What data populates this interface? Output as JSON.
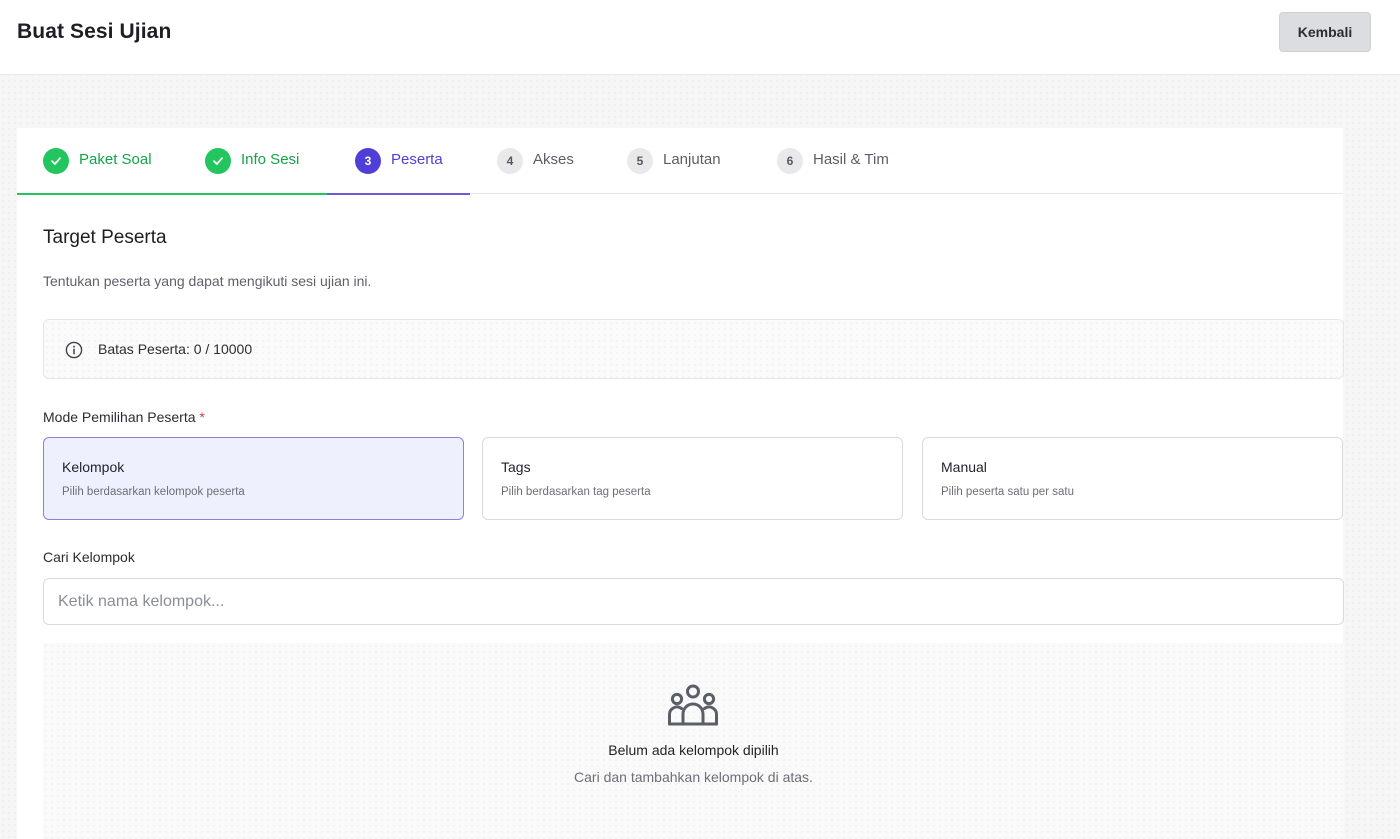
{
  "header": {
    "title": "Buat Sesi Ujian",
    "back_label": "Kembali"
  },
  "stepper": {
    "steps": [
      {
        "number": "1",
        "label": "Paket Soal",
        "state": "done"
      },
      {
        "number": "2",
        "label": "Info Sesi",
        "state": "done"
      },
      {
        "number": "3",
        "label": "Peserta",
        "state": "active"
      },
      {
        "number": "4",
        "label": "Akses",
        "state": "todo"
      },
      {
        "number": "5",
        "label": "Lanjutan",
        "state": "todo"
      },
      {
        "number": "6",
        "label": "Hasil & Tim",
        "state": "todo"
      }
    ]
  },
  "section": {
    "title": "Target Peserta",
    "description": "Tentukan peserta yang dapat mengikuti sesi ujian ini."
  },
  "quota": {
    "label": "Batas Peserta: 0 / 10000",
    "icon": "info-icon"
  },
  "mode": {
    "label": "Mode Pemilihan Peserta",
    "required_mark": "*",
    "options": [
      {
        "title": "Kelompok",
        "description": "Pilih berdasarkan kelompok peserta",
        "selected": true
      },
      {
        "title": "Tags",
        "description": "Pilih berdasarkan tag peserta",
        "selected": false
      },
      {
        "title": "Manual",
        "description": "Pilih peserta satu per satu",
        "selected": false
      }
    ]
  },
  "search": {
    "label": "Cari Kelompok",
    "placeholder": "Ketik nama kelompok...",
    "value": ""
  },
  "empty_state": {
    "icon": "users-group-icon",
    "title": "Belum ada kelompok dipilih",
    "subtitle": "Cari dan tambahkan kelompok di atas."
  },
  "colors": {
    "accent": "#4f3fd8",
    "success": "#22c55e",
    "required": "#e23b3b",
    "selected_card_bg": "#eef0fd"
  }
}
